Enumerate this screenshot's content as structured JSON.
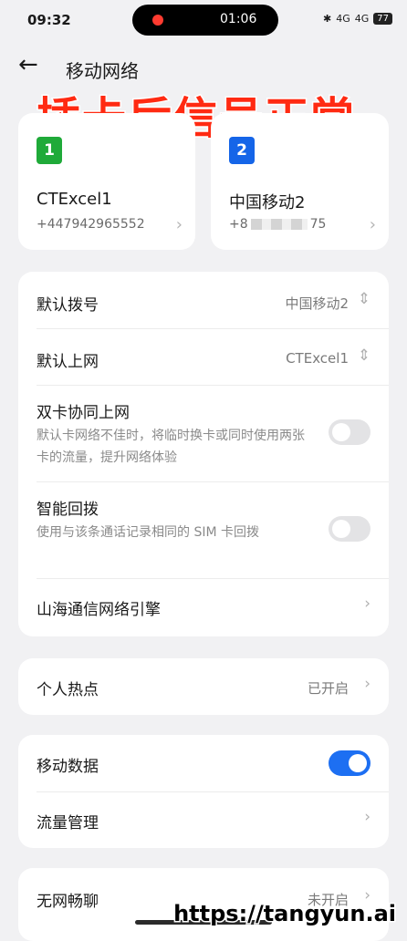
{
  "status": {
    "time": "09:32",
    "call_time": "01:06",
    "bluetooth": "✱",
    "net1": "4G",
    "net2": "4G",
    "battery": "77"
  },
  "header": {
    "title": "移动网络",
    "overlay_caption": "插卡后信号正常"
  },
  "sims": [
    {
      "slot": "1",
      "name": "CTExcel1",
      "number": "+447942965552",
      "color": "#1faa39"
    },
    {
      "slot": "2",
      "name": "中国移动2",
      "number": "+8",
      "number_tail": "75",
      "color": "#1565e8"
    }
  ],
  "settings": {
    "default_dial": {
      "label": "默认拨号",
      "value": "中国移动2"
    },
    "default_data": {
      "label": "默认上网",
      "value": "CTExcel1"
    },
    "dual_sim": {
      "label": "双卡协同上网",
      "desc": "默认卡网络不佳时，将临时换卡或同时使用两张卡的流量，提升网络体验",
      "enabled": false
    },
    "smart_callback": {
      "label": "智能回拨",
      "desc": "使用与该条通话记录相同的 SIM 卡回拨",
      "enabled": false
    },
    "engine": {
      "label": "山海通信网络引擎"
    }
  },
  "hotspot": {
    "label": "个人热点",
    "value": "已开启"
  },
  "mobile_data": {
    "label": "移动数据",
    "enabled": true
  },
  "traffic": {
    "label": "流量管理"
  },
  "offline_chat": {
    "label": "无网畅聊",
    "value": "未开启"
  },
  "watermark": "https://tangyun.ai"
}
